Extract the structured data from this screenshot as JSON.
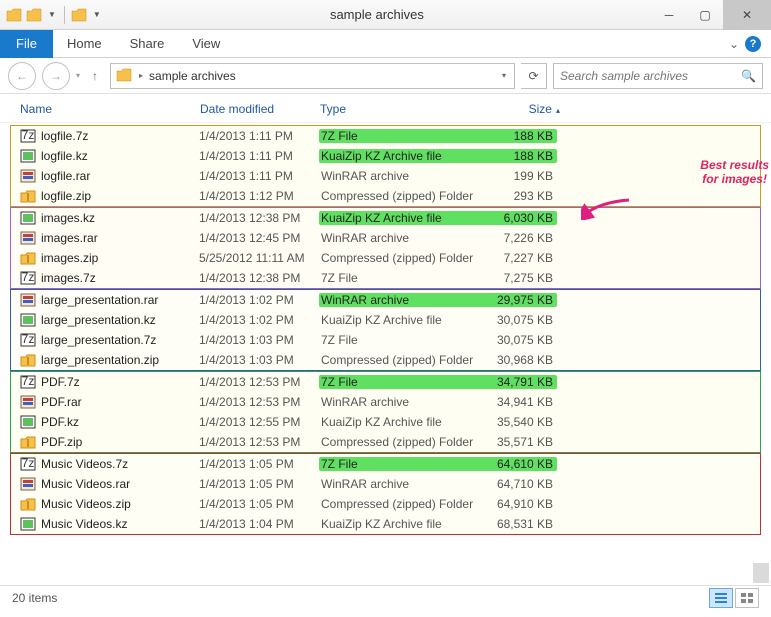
{
  "window": {
    "title": "sample archives"
  },
  "ribbon": {
    "file": "File",
    "home": "Home",
    "share": "Share",
    "view": "View"
  },
  "path": {
    "folder": "sample archives",
    "search_placeholder": "Search sample archives"
  },
  "headers": {
    "name": "Name",
    "date": "Date modified",
    "type": "Type",
    "size": "Size"
  },
  "status": {
    "count": "20 items"
  },
  "callout": {
    "line1": "Best results",
    "line2": "for images!"
  },
  "groups": [
    {
      "cls": "g-yellow",
      "rows": [
        {
          "icon": "7z",
          "name": "logfile.7z",
          "date": "1/4/2013 1:11 PM",
          "type": "7Z File",
          "size": "188 KB",
          "hl": true
        },
        {
          "icon": "kz",
          "name": "logfile.kz",
          "date": "1/4/2013 1:11 PM",
          "type": "KuaiZip KZ Archive file",
          "size": "188 KB",
          "hl": true
        },
        {
          "icon": "rar",
          "name": "logfile.rar",
          "date": "1/4/2013 1:11 PM",
          "type": "WinRAR archive",
          "size": "199 KB",
          "hl": false
        },
        {
          "icon": "zip",
          "name": "logfile.zip",
          "date": "1/4/2013 1:12 PM",
          "type": "Compressed (zipped) Folder",
          "size": "293 KB",
          "hl": false
        }
      ]
    },
    {
      "cls": "g-purple",
      "rows": [
        {
          "icon": "kz",
          "name": "images.kz",
          "date": "1/4/2013 12:38 PM",
          "type": "KuaiZip KZ Archive file",
          "size": "6,030 KB",
          "hl": true
        },
        {
          "icon": "rar",
          "name": "images.rar",
          "date": "1/4/2013 12:45 PM",
          "type": "WinRAR archive",
          "size": "7,226 KB",
          "hl": false
        },
        {
          "icon": "zip",
          "name": "images.zip",
          "date": "5/25/2012 11:11 AM",
          "type": "Compressed (zipped) Folder",
          "size": "7,227 KB",
          "hl": false
        },
        {
          "icon": "7z",
          "name": "images.7z",
          "date": "1/4/2013 12:38 PM",
          "type": "7Z File",
          "size": "7,275 KB",
          "hl": false
        }
      ]
    },
    {
      "cls": "g-blue",
      "rows": [
        {
          "icon": "rar",
          "name": "large_presentation.rar",
          "date": "1/4/2013 1:02 PM",
          "type": "WinRAR archive",
          "size": "29,975 KB",
          "hl": true
        },
        {
          "icon": "kz",
          "name": "large_presentation.kz",
          "date": "1/4/2013 1:02 PM",
          "type": "KuaiZip KZ Archive file",
          "size": "30,075 KB",
          "hl": false
        },
        {
          "icon": "7z",
          "name": "large_presentation.7z",
          "date": "1/4/2013 1:03 PM",
          "type": "7Z File",
          "size": "30,075 KB",
          "hl": false
        },
        {
          "icon": "zip",
          "name": "large_presentation.zip",
          "date": "1/4/2013 1:03 PM",
          "type": "Compressed (zipped) Folder",
          "size": "30,968 KB",
          "hl": false
        }
      ]
    },
    {
      "cls": "g-green",
      "rows": [
        {
          "icon": "7z",
          "name": "PDF.7z",
          "date": "1/4/2013 12:53 PM",
          "type": "7Z File",
          "size": "34,791 KB",
          "hl": true
        },
        {
          "icon": "rar",
          "name": "PDF.rar",
          "date": "1/4/2013 12:53 PM",
          "type": "WinRAR archive",
          "size": "34,941 KB",
          "hl": false
        },
        {
          "icon": "kz",
          "name": "PDF.kz",
          "date": "1/4/2013 12:55 PM",
          "type": "KuaiZip KZ Archive file",
          "size": "35,540 KB",
          "hl": false
        },
        {
          "icon": "zip",
          "name": "PDF.zip",
          "date": "1/4/2013 12:53 PM",
          "type": "Compressed (zipped) Folder",
          "size": "35,571 KB",
          "hl": false
        }
      ]
    },
    {
      "cls": "g-red",
      "rows": [
        {
          "icon": "7z",
          "name": "Music Videos.7z",
          "date": "1/4/2013 1:05 PM",
          "type": "7Z File",
          "size": "64,610 KB",
          "hl": true
        },
        {
          "icon": "rar",
          "name": "Music Videos.rar",
          "date": "1/4/2013 1:05 PM",
          "type": "WinRAR archive",
          "size": "64,710 KB",
          "hl": false
        },
        {
          "icon": "zip",
          "name": "Music Videos.zip",
          "date": "1/4/2013 1:05 PM",
          "type": "Compressed (zipped) Folder",
          "size": "64,910 KB",
          "hl": false
        },
        {
          "icon": "kz",
          "name": "Music Videos.kz",
          "date": "1/4/2013 1:04 PM",
          "type": "KuaiZip KZ Archive file",
          "size": "68,531 KB",
          "hl": false
        }
      ]
    }
  ]
}
